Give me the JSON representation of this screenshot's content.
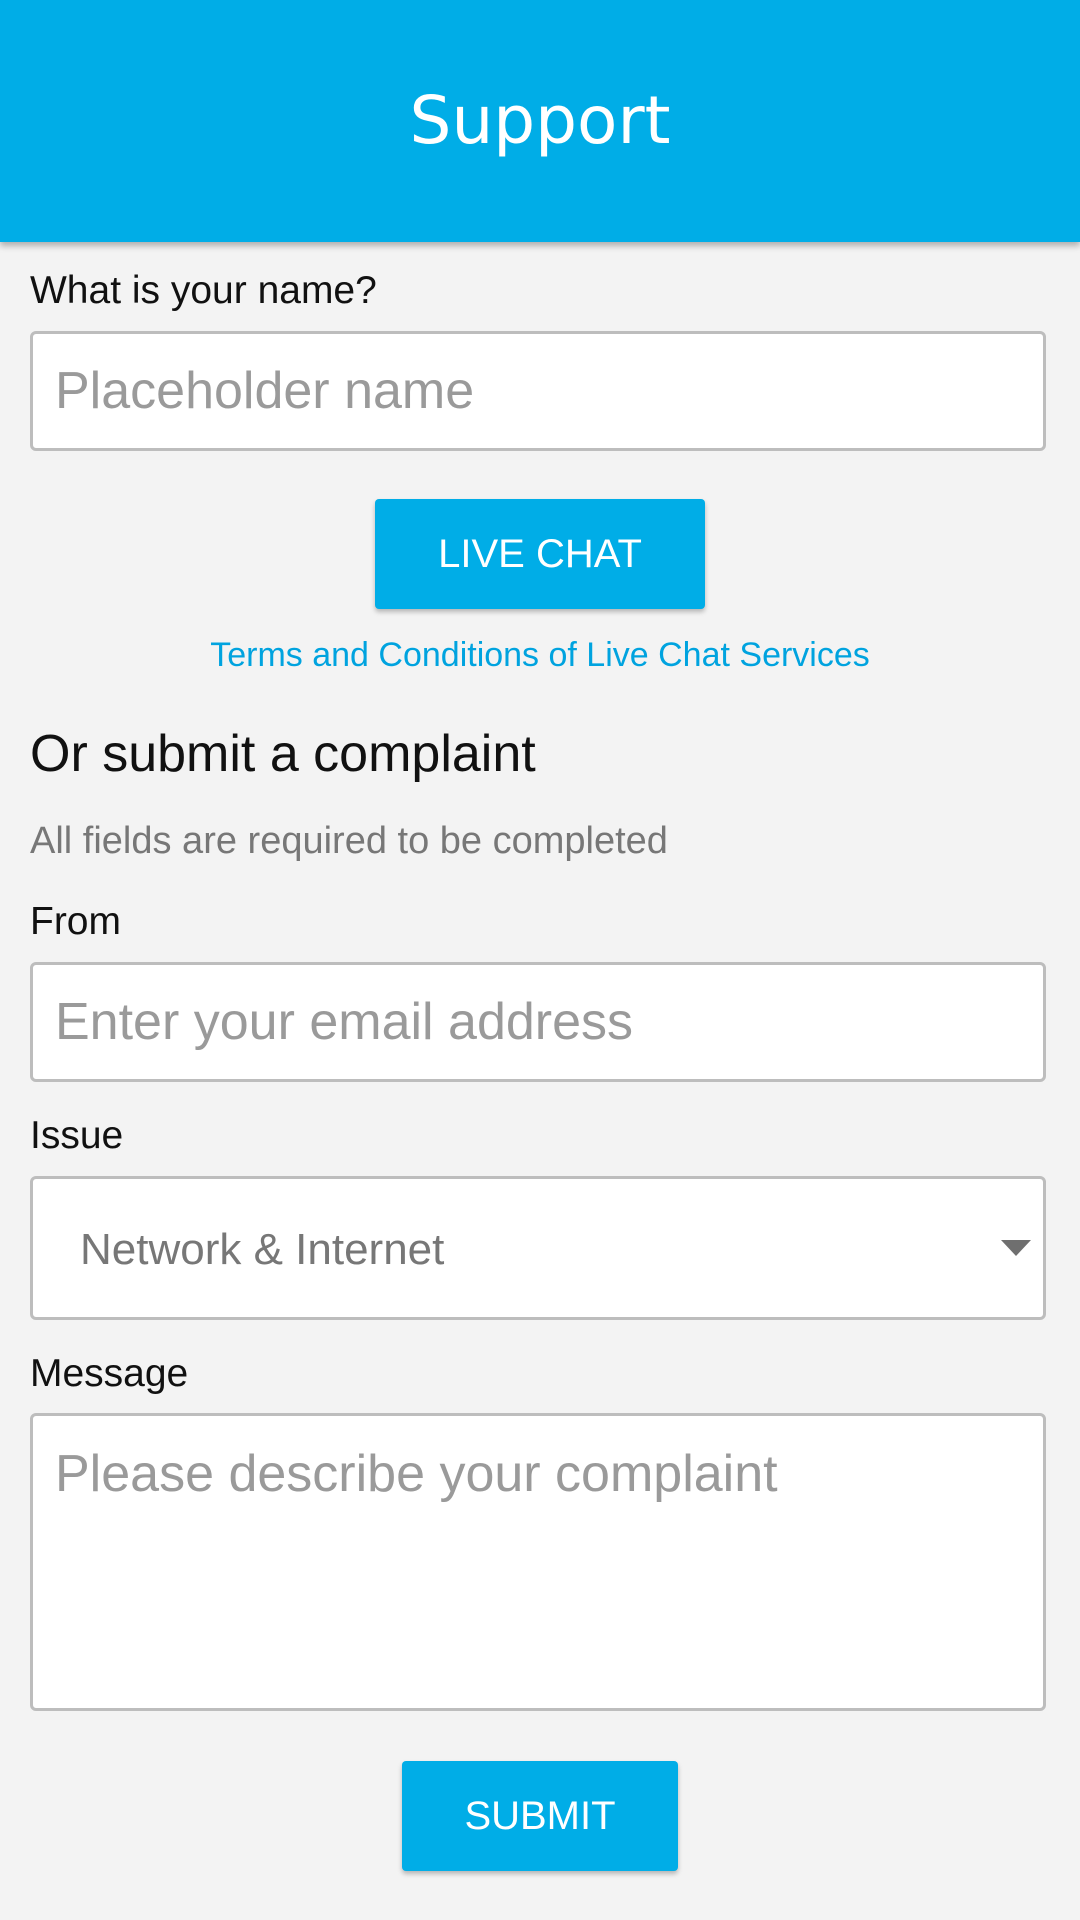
{
  "header": {
    "title": "Support"
  },
  "name_section": {
    "label": "What is your name?",
    "placeholder": "Placeholder name"
  },
  "live_chat": {
    "button_label": "LIVE CHAT",
    "terms_link": "Terms and Conditions of Live Chat Services"
  },
  "complaint": {
    "heading": "Or submit a complaint",
    "helper_text": "All fields are required to be completed",
    "from_label": "From",
    "from_placeholder": "Enter your email address",
    "issue_label": "Issue",
    "issue_value": "Network & Internet",
    "message_label": "Message",
    "message_placeholder": "Please describe your complaint",
    "submit_label": "SUBMIT"
  },
  "colors": {
    "accent": "#00ade7",
    "background": "#f3f3f3"
  },
  "icons": {
    "issue_dropdown": "chevron-down-icon"
  }
}
